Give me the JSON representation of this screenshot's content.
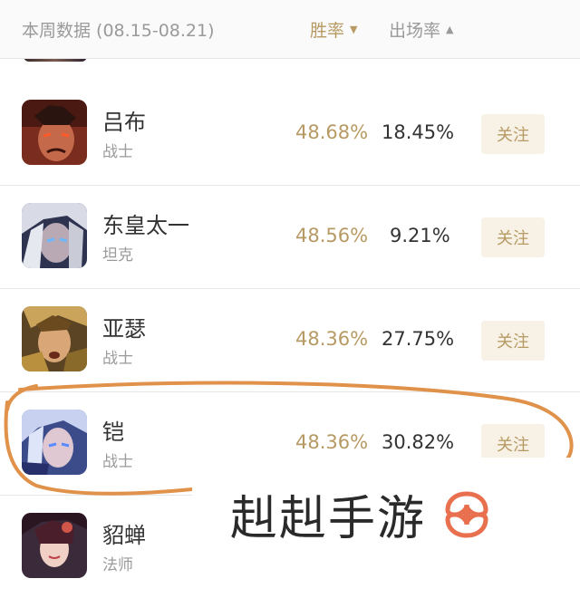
{
  "header": {
    "period": "本周数据 (08.15-08.21)",
    "win_rate_label": "胜率",
    "win_rate_caret": "▼",
    "pick_rate_label": "出场率",
    "pick_rate_caret": "▲"
  },
  "heroes": [
    {
      "name": "吕布",
      "role": "战士",
      "win_rate": "48.68%",
      "pick_rate": "18.45%",
      "follow": "关注"
    },
    {
      "name": "东皇太一",
      "role": "坦克",
      "win_rate": "48.56%",
      "pick_rate": "9.21%",
      "follow": "关注"
    },
    {
      "name": "亚瑟",
      "role": "战士",
      "win_rate": "48.36%",
      "pick_rate": "27.75%",
      "follow": "关注"
    },
    {
      "name": "铠",
      "role": "战士",
      "win_rate": "48.36%",
      "pick_rate": "30.82%",
      "follow": "关注"
    },
    {
      "name": "貂蝉",
      "role": "法师",
      "win_rate": "",
      "pick_rate": "",
      "follow": ""
    }
  ],
  "watermark": {
    "text": "赳赳手游",
    "logo_color": "#e8704f"
  },
  "annotation_color": "#e0914a",
  "accent_color": "#b79a63"
}
